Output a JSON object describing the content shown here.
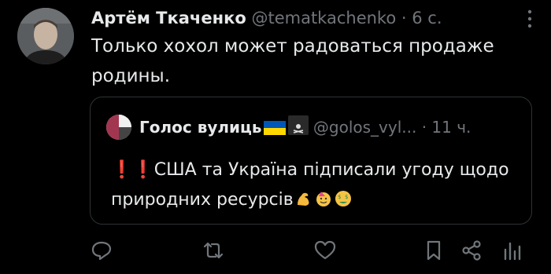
{
  "tweet": {
    "display_name": "Артём Ткаченко",
    "handle": "@tematkachenko",
    "separator": "·",
    "time": "6 с.",
    "text": "Только хохол может радоваться продаже родины."
  },
  "quote": {
    "display_name": "Голос вулиць",
    "handle": "@golos_vyl...",
    "separator": "·",
    "time": "11 ч.",
    "excl": "❗❗",
    "text": "США та Україна підписали угоду щодо природних ресурсів"
  },
  "icons": [
    "reply-icon",
    "retweet-icon",
    "like-icon",
    "bookmark-icon",
    "share-icon",
    "views-icon",
    "more-icon"
  ],
  "colors": {
    "background": "#000000",
    "text": "#e7e9ea",
    "muted": "#71767b",
    "border": "#2f3336",
    "flag_blue": "#0057b7",
    "flag_yellow": "#ffd700"
  }
}
